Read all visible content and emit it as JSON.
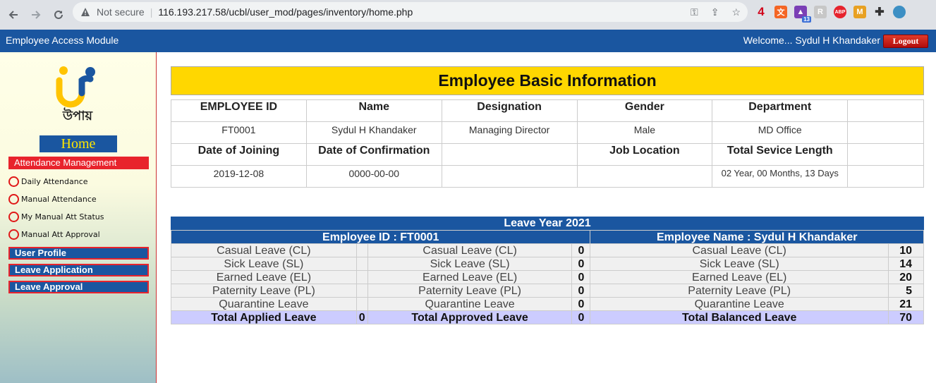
{
  "browser": {
    "not_secure": "Not secure",
    "url": "116.193.217.58/ucbl/user_mod/pages/inventory/home.php",
    "ext_badge_4": "4",
    "ext_badge_13": "13",
    "ext_abp": "ABP"
  },
  "header": {
    "title": "Employee Access Module",
    "welcome": "Welcome... Sydul H Khandaker",
    "logout": "Logout"
  },
  "sidebar": {
    "logo_text": "উপায়",
    "home": "Home",
    "attendance_heading": "Attendance Management",
    "attendance_items": [
      "Daily Attendance",
      "Manual Attendance",
      "My Manual Att Status",
      "Manual Att Approval"
    ],
    "menu": [
      "User Profile",
      "Leave Application",
      "Leave Approval"
    ]
  },
  "basic_info": {
    "title": "Employee Basic Information",
    "headers1": [
      "EMPLOYEE ID",
      "Name",
      "Designation",
      "Gender",
      "Department"
    ],
    "values1": [
      "FT0001",
      "Sydul H Khandaker",
      "Managing Director",
      "Male",
      "MD Office"
    ],
    "headers2": [
      "Date of Joining",
      "Date of Confirmation",
      "",
      "Job Location",
      "Total Sevice Length"
    ],
    "values2": [
      "2019-12-08",
      "0000-00-00",
      "",
      "",
      "02 Year, 00 Months, 13 Days"
    ]
  },
  "leave": {
    "title": "Leave Year 2021",
    "employee_id_label": "Employee ID : FT0001",
    "employee_name_label": "Employee Name : Sydul H Khandaker",
    "rows": [
      {
        "applied_type": "Casual Leave (CL)",
        "applied": "",
        "approved_type": "Casual Leave (CL)",
        "approved": "0",
        "balanced_type": "Casual Leave (CL)",
        "balanced": "10"
      },
      {
        "applied_type": "Sick Leave (SL)",
        "applied": "",
        "approved_type": "Sick Leave (SL)",
        "approved": "0",
        "balanced_type": "Sick Leave (SL)",
        "balanced": "14"
      },
      {
        "applied_type": "Earned Leave (EL)",
        "applied": "",
        "approved_type": "Earned Leave (EL)",
        "approved": "0",
        "balanced_type": "Earned Leave (EL)",
        "balanced": "20"
      },
      {
        "applied_type": "Paternity Leave (PL)",
        "applied": "",
        "approved_type": "Paternity Leave (PL)",
        "approved": "0",
        "balanced_type": "Paternity Leave (PL)",
        "balanced": "5"
      },
      {
        "applied_type": "Quarantine Leave",
        "applied": "",
        "approved_type": "Quarantine Leave",
        "approved": "0",
        "balanced_type": "Quarantine Leave",
        "balanced": "21"
      }
    ],
    "totals": {
      "applied_label": "Total Applied Leave",
      "applied": "0",
      "approved_label": "Total Approved Leave",
      "approved": "0",
      "balanced_label": "Total Balanced Leave",
      "balanced": "70"
    }
  },
  "colors": {
    "header_blue": "#1a56a0",
    "title_yellow": "#ffd700",
    "logout_red": "#c41a1a",
    "total_row": "#ccccff"
  }
}
